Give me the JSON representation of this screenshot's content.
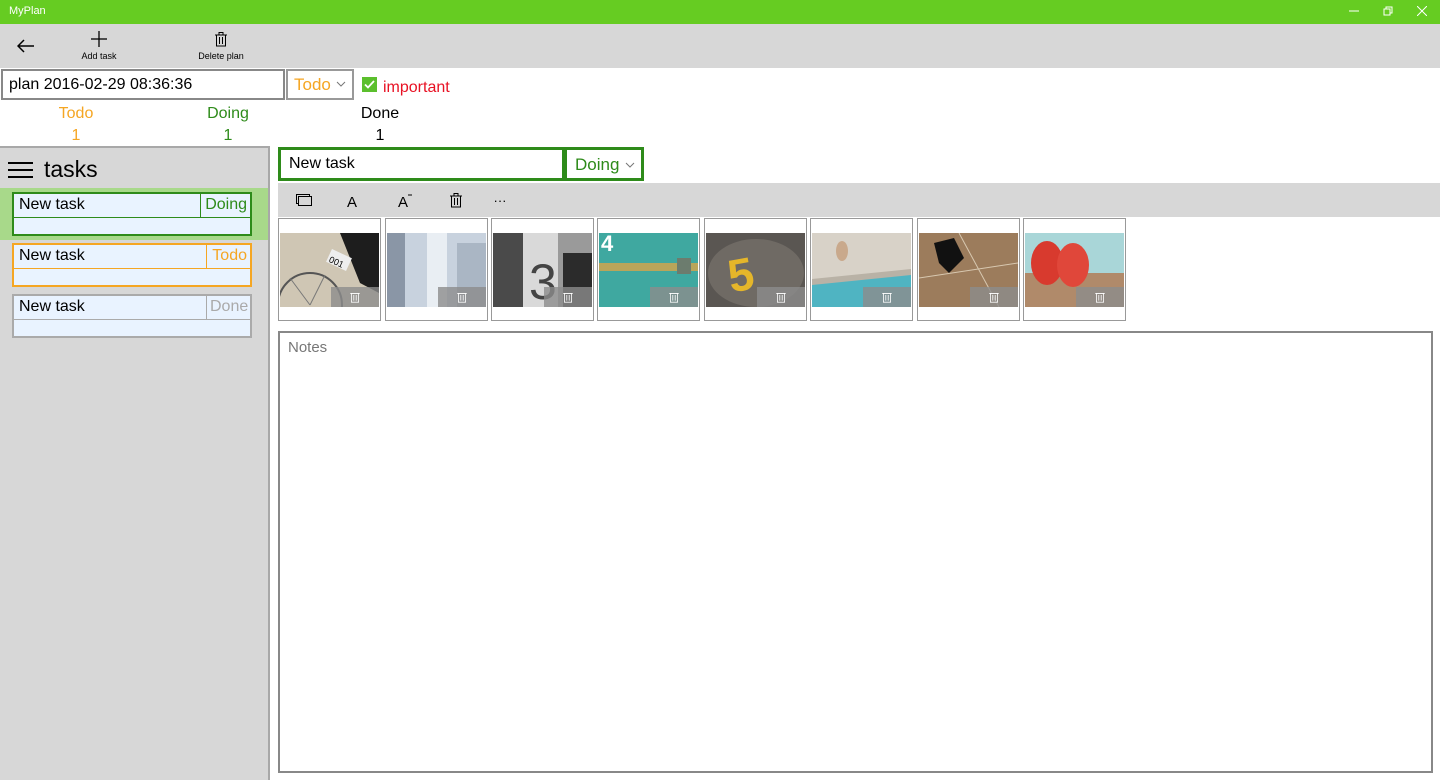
{
  "window": {
    "title": "MyPlan",
    "controls": [
      "minimize",
      "restore",
      "close"
    ]
  },
  "commandbar": {
    "back_icon": "back-arrow-icon",
    "add_task_label": "Add task",
    "delete_plan_label": "Delete plan"
  },
  "plan": {
    "name": "plan 2016-02-29 08:36:36",
    "status": "Todo",
    "important_label": "important",
    "important_checked": true
  },
  "counters": [
    {
      "label": "Todo",
      "count": "1",
      "color": "#f5a623"
    },
    {
      "label": "Doing",
      "count": "1",
      "color": "#2e8b1a"
    },
    {
      "label": "Done",
      "count": "1",
      "color": "#000000"
    }
  ],
  "tasks_panel": {
    "title": "tasks",
    "items": [
      {
        "name": "New task",
        "status": "Doing",
        "color": "#2e8b1a",
        "selected": true
      },
      {
        "name": "New task",
        "status": "Todo",
        "color": "#f5a623",
        "selected": false
      },
      {
        "name": "New task",
        "status": "Done",
        "color": "#aaaaaa",
        "selected": false
      }
    ]
  },
  "detail": {
    "task_name": "New task",
    "task_status": "Doing",
    "toolbar": {
      "more_label": "···"
    },
    "images": [
      "bicycle-photo",
      "hallway-photo",
      "number-3-photo",
      "number-4-photo",
      "number-5-photo",
      "pool-photo",
      "shadow-photo",
      "red-shoes-photo"
    ],
    "notes_placeholder": "Notes"
  }
}
